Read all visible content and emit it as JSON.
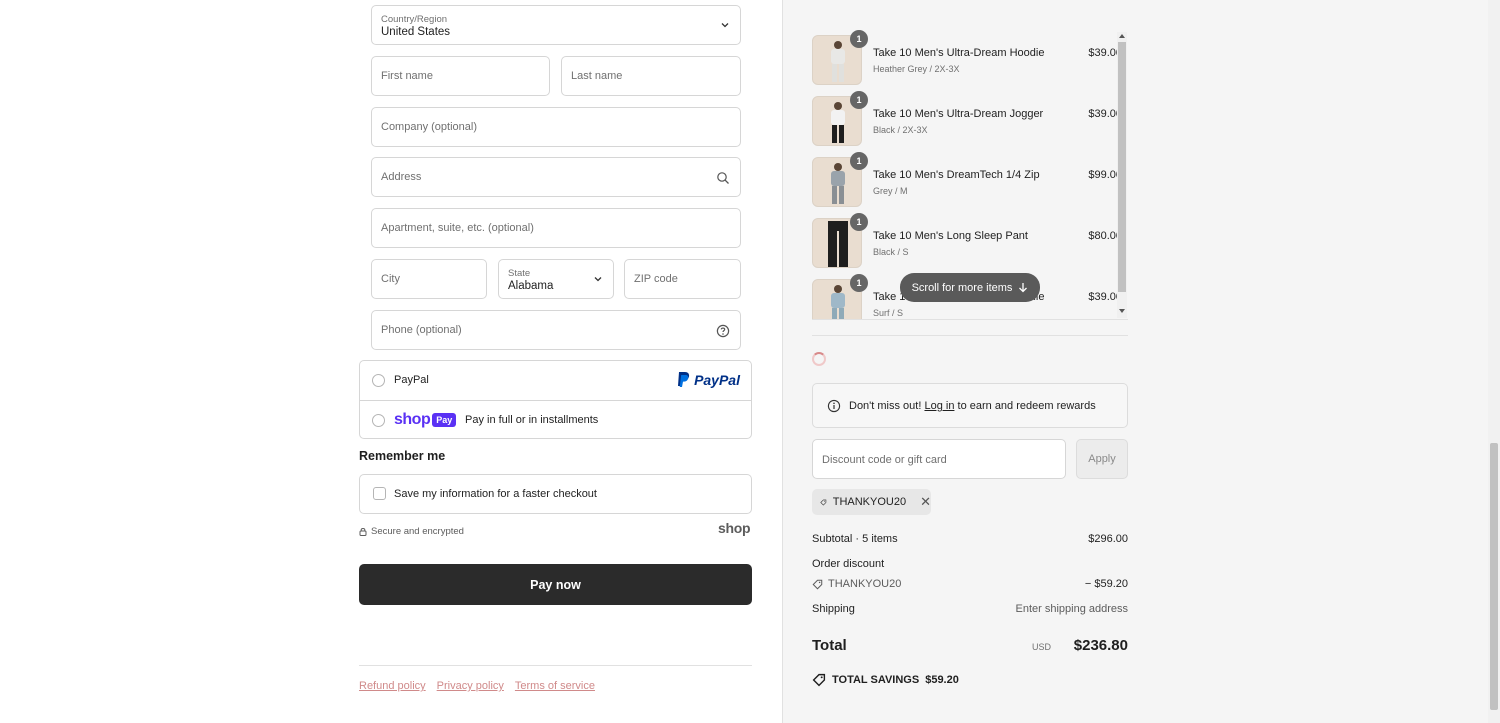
{
  "form": {
    "country": {
      "label": "Country/Region",
      "value": "United States"
    },
    "first_name": {
      "placeholder": "First name"
    },
    "last_name": {
      "placeholder": "Last name"
    },
    "company": {
      "placeholder": "Company (optional)"
    },
    "address": {
      "placeholder": "Address"
    },
    "apartment": {
      "placeholder": "Apartment, suite, etc. (optional)"
    },
    "city": {
      "placeholder": "City"
    },
    "state": {
      "label": "State",
      "value": "Alabama"
    },
    "zip": {
      "placeholder": "ZIP code"
    },
    "phone": {
      "placeholder": "Phone (optional)"
    }
  },
  "payment": {
    "paypal_label": "PayPal",
    "paypal_logo": "PayPal",
    "shop_logo": "shop",
    "shop_badge": "Pay",
    "shop_label": "Pay in full or in installments"
  },
  "remember": {
    "title": "Remember me",
    "save_label": "Save my information for a faster checkout",
    "secure": "Secure and encrypted",
    "shop_mark": "shop"
  },
  "pay_now": "Pay now",
  "footer": {
    "links": [
      "Refund policy",
      "Privacy policy",
      "Terms of service"
    ]
  },
  "order": {
    "items": [
      {
        "qty": "1",
        "name": "Take 10 Men's Ultra-Dream Hoodie",
        "variant": "Heather Grey / 2X-3X",
        "price": "$39.00"
      },
      {
        "qty": "1",
        "name": "Take 10 Men's Ultra-Dream Jogger",
        "variant": "Black / 2X-3X",
        "price": "$39.00"
      },
      {
        "qty": "1",
        "name": "Take 10 Men's DreamTech 1/4 Zip",
        "variant": "Grey / M",
        "price": "$99.00"
      },
      {
        "qty": "1",
        "name": "Take 10 Men's Long Sleep Pant",
        "variant": "Black / S",
        "price": "$80.00"
      },
      {
        "qty": "1",
        "name": "Take 10 Men's Ultra-Dream Hoodie",
        "variant": "Surf / S",
        "price": "$39.00"
      }
    ],
    "scroll_hint": "Scroll for more items",
    "notice_pre": "Don't miss out!",
    "notice_link": "Log in",
    "notice_post": "to earn and redeem rewards",
    "discount_placeholder": "Discount code or gift card",
    "apply": "Apply",
    "applied_code": "THANKYOU20",
    "subtotal_label": "Subtotal · 5 items",
    "subtotal_value": "$296.00",
    "order_discount_label": "Order discount",
    "discount_code": "THANKYOU20",
    "discount_value": "− $59.20",
    "shipping_label": "Shipping",
    "shipping_value": "Enter shipping address",
    "total_label": "Total",
    "currency": "USD",
    "total_value": "$236.80",
    "savings_label": "TOTAL SAVINGS",
    "savings_value": "$59.20"
  },
  "colors": {
    "pay_button": "#2b2b2b",
    "paypal_blue": "#003087",
    "paypal_light": "#0070e0",
    "shop_purple": "#5a31f4",
    "link_pink": "#d08a8a"
  }
}
